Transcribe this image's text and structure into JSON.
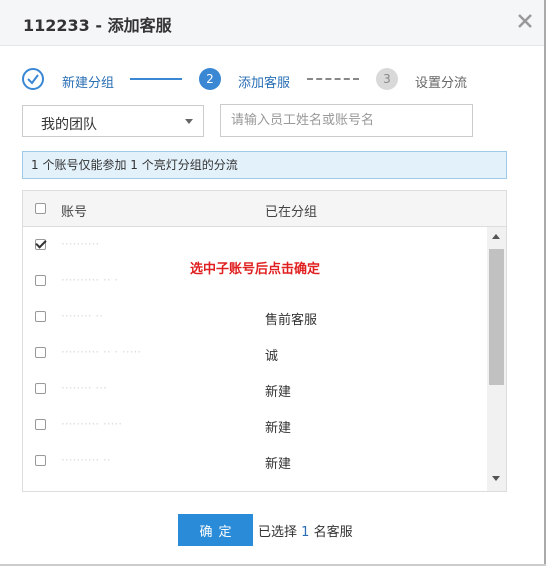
{
  "dialog": {
    "title": "112233 - 添加客服"
  },
  "steps": [
    {
      "label": "新建分组",
      "number": "✓",
      "state": "done"
    },
    {
      "label": "添加客服",
      "number": "2",
      "state": "active"
    },
    {
      "label": "设置分流",
      "number": "3",
      "state": "pending"
    }
  ],
  "filter": {
    "team": "我的团队",
    "search_placeholder": "请输入员工姓名或账号名"
  },
  "notice": "1 个账号仅能参加 1 个亮灯分组的分流",
  "table": {
    "headers": {
      "account": "账号",
      "group": "已在分组"
    },
    "rows": [
      {
        "account": "··········",
        "group": "",
        "checked": true
      },
      {
        "account": "·········· ·· ·",
        "group": "",
        "checked": false
      },
      {
        "account": "········ ··",
        "group": "售前客服",
        "checked": false
      },
      {
        "account": "·········· ·· · ·····",
        "group": "诚",
        "checked": false
      },
      {
        "account": "········ ···",
        "group": "新建",
        "checked": false
      },
      {
        "account": "·········· ·····",
        "group": "新建",
        "checked": false
      },
      {
        "account": "·········· ··",
        "group": "新建",
        "checked": false
      },
      {
        "account": "······",
        "group": "",
        "checked": false
      }
    ]
  },
  "annotation": "选中子账号后点击确定",
  "footer": {
    "confirm": "确定",
    "selected_prefix": "已选择",
    "selected_count": "1",
    "selected_suffix": "名客服"
  },
  "colors": {
    "accent": "#2a8bd8",
    "annotation": "#e02020"
  }
}
